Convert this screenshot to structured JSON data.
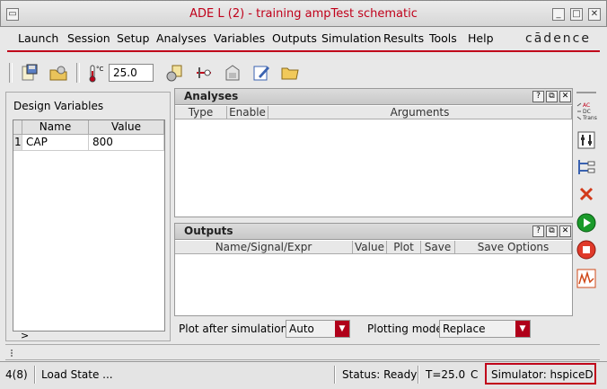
{
  "window": {
    "title": "ADE L (2) - training ampTest schematic"
  },
  "menu": {
    "items": [
      "Launch",
      "Session",
      "Setup",
      "Analyses",
      "Variables",
      "Outputs",
      "Simulation",
      "Results",
      "Tools",
      "Help"
    ],
    "brand": "cādence"
  },
  "toolbar": {
    "temperature_value": "25.0",
    "temp_unit": "°C"
  },
  "design_variables": {
    "title": "Design Variables",
    "columns": [
      "Name",
      "Value"
    ],
    "rows": [
      {
        "index": "1",
        "name": "CAP",
        "value": "800"
      }
    ],
    "more": ">"
  },
  "analyses": {
    "title": "Analyses",
    "columns": [
      "Type",
      "Enable",
      "Arguments"
    ]
  },
  "outputs": {
    "title": "Outputs",
    "columns": [
      "Name/Signal/Expr",
      "Value",
      "Plot",
      "Save",
      "Save Options"
    ]
  },
  "plot_controls": {
    "plot_after_label": "Plot after simulation:",
    "plot_after_value": "Auto",
    "plotting_mode_label": "Plotting mode:",
    "plotting_mode_value": "Replace"
  },
  "sidebar": {
    "analysis_labels": [
      "AC",
      "DC",
      "Trans"
    ]
  },
  "status": {
    "index": "4(8)",
    "message": "Load State ...",
    "state": "Status: Ready",
    "temp": "T=25.0",
    "unit": "C",
    "simulator": "Simulator: hspiceD"
  },
  "colors": {
    "accent": "#c0001a",
    "run_green": "#1a9a2a"
  }
}
